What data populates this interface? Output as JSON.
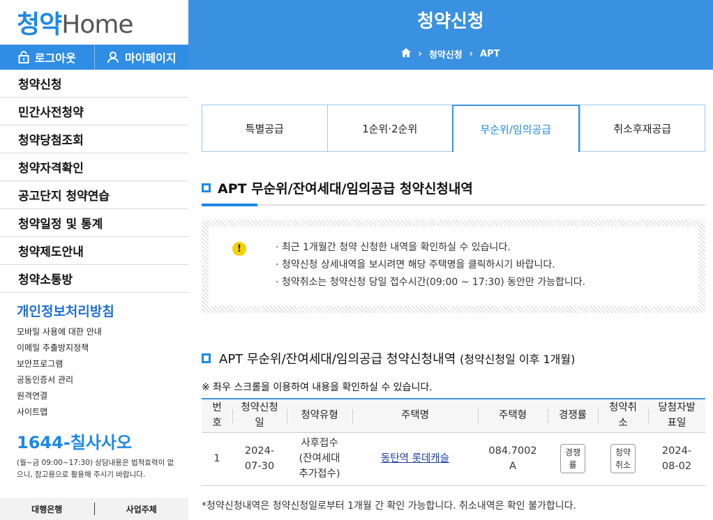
{
  "logo": {
    "part1": "청약",
    "part2": "Home"
  },
  "login_bar": {
    "logout": "로그아웃",
    "mypage": "마이페이지"
  },
  "menu": [
    "청약신청",
    "민간사전청약",
    "청약당첨조회",
    "청약자격확인",
    "공고단지 청약연습",
    "청약일정 및 통계",
    "청약제도안내",
    "청약소통방"
  ],
  "privacy": {
    "title": "개인정보처리방침",
    "links": [
      "모바일 사용에 대한 안내",
      "이메일 추출방지정책",
      "보안프로그램",
      "공동인증서 관리",
      "원격연결",
      "사이트맵"
    ]
  },
  "contact": {
    "phone": "1644-칠사사오",
    "note": "(월~금 09:00~17:30) 상담내용은 법적효력이 없으니, 참고용으로 활용해 주시기 바랍니다."
  },
  "bottom_bar": {
    "left": "대행은행",
    "right": "사업주체"
  },
  "header": {
    "title": "청약신청",
    "crumb1": "청약신청",
    "crumb2": "APT"
  },
  "tabs": [
    "특별공급",
    "1순위·2순위",
    "무순위/임의공급",
    "취소후재공급"
  ],
  "section1": {
    "title": "APT 무순위/잔여세대/임의공급 청약신청내역"
  },
  "notice": [
    "· 최근 1개월간 청약 신청한 내역을 확인하실 수 있습니다.",
    "· 청약신청 상세내역을 보시려면 해당 주택명을 클릭하시기 바랍니다.",
    "· 청약취소는 청약신청 당일 접수시간(09:00 ~ 17:30) 동안만 가능합니다."
  ],
  "section2": {
    "title": "APT 무순위/잔여세대/임의공급 청약신청내역",
    "sub": "(청약신청일 이후 1개월)"
  },
  "scroll_note": "※ 좌우 스크롤을 이용하여 내용을 확인하실 수 있습니다.",
  "table": {
    "headers": [
      "번\n호",
      "청약신청\n일",
      "청약유형",
      "주택명",
      "주택형",
      "경쟁률",
      "청약취\n소",
      "당첨자발\n표일"
    ],
    "row": {
      "no": "1",
      "date": "2024-\n07-30",
      "type": "사후접수\n(잔여세대\n추가접수)",
      "house": "동탄역 롯데캐슬",
      "house_type": "084.7002\nA",
      "competition_btn": "경쟁\n률",
      "cancel_btn": "청약\n취소",
      "announce": "2024-\n08-02"
    }
  },
  "foot_note": "*청약신청내역은 청약신청일로부터 1개월 간 확인 가능합니다. 취소내역은 확인 불가합니다."
}
